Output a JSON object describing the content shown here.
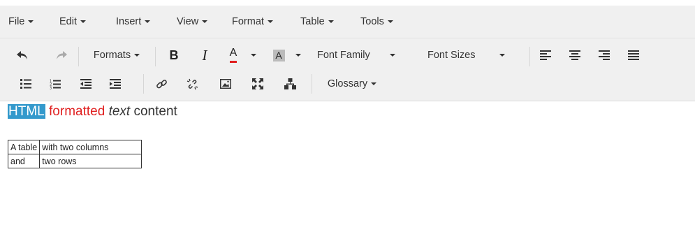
{
  "menubar": {
    "items": [
      "File",
      "Edit",
      "Insert",
      "View",
      "Format",
      "Table",
      "Tools"
    ]
  },
  "toolbar": {
    "undo_icon": "undo-icon",
    "redo_icon": "redo-icon",
    "formats_label": "Formats",
    "bold_label": "B",
    "italic_label": "I",
    "text_color_label": "A",
    "bg_color_label": "A",
    "font_family_label": "Font Family",
    "font_sizes_label": "Font Sizes",
    "glossary_label": "Glossary",
    "text_color_value": "#e02020",
    "highlight_color_value": "#bbbbbb"
  },
  "content": {
    "highlight_word": "HTML",
    "red_word": "formatted",
    "italic_word": "text",
    "plain_word": "content",
    "table": [
      [
        "A table",
        "with two columns"
      ],
      [
        "and",
        "two rows"
      ]
    ]
  }
}
